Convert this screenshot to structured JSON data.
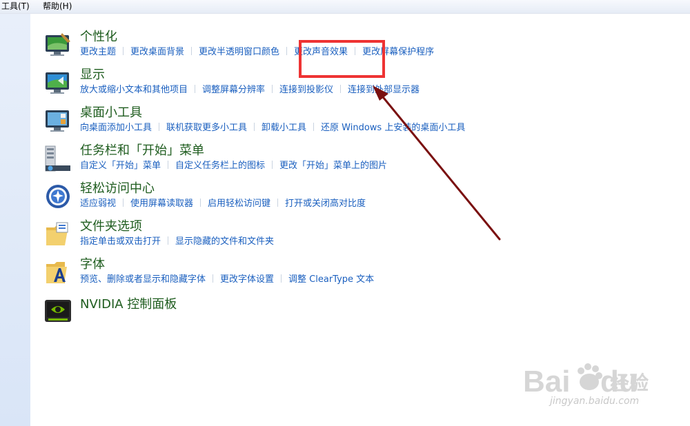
{
  "menubar": {
    "tools": "工具(T)",
    "help": "帮助(H)"
  },
  "categories": [
    {
      "title": "个性化",
      "links": [
        "更改主题",
        "更改桌面背景",
        "更改半透明窗口颜色",
        "更改声音效果",
        "更改屏幕保护程序"
      ]
    },
    {
      "title": "显示",
      "links": [
        "放大或缩小文本和其他项目",
        "调整屏幕分辨率",
        "连接到投影仪",
        "连接到外部显示器"
      ]
    },
    {
      "title": "桌面小工具",
      "links": [
        "向桌面添加小工具",
        "联机获取更多小工具",
        "卸载小工具",
        "还原 Windows 上安装的桌面小工具"
      ]
    },
    {
      "title": "任务栏和「开始」菜单",
      "links": [
        "自定义「开始」菜单",
        "自定义任务栏上的图标",
        "更改「开始」菜单上的图片"
      ]
    },
    {
      "title": "轻松访问中心",
      "links": [
        "适应弱视",
        "使用屏幕读取器",
        "启用轻松访问键",
        "打开或关闭高对比度"
      ]
    },
    {
      "title": "文件夹选项",
      "links": [
        "指定单击或双击打开",
        "显示隐藏的文件和文件夹"
      ]
    },
    {
      "title": "字体",
      "links": [
        "预览、删除或者显示和隐藏字体",
        "更改字体设置",
        "调整 ClearType 文本"
      ]
    },
    {
      "title": "NVIDIA 控制面板",
      "links": []
    }
  ],
  "annotation": {
    "highlight_color": "#ee3333",
    "arrow_color": "#7a1010"
  },
  "watermark": {
    "brand": "Bai",
    "brand2": "du",
    "cn": "经验",
    "url": "jingyan.baidu.com"
  }
}
